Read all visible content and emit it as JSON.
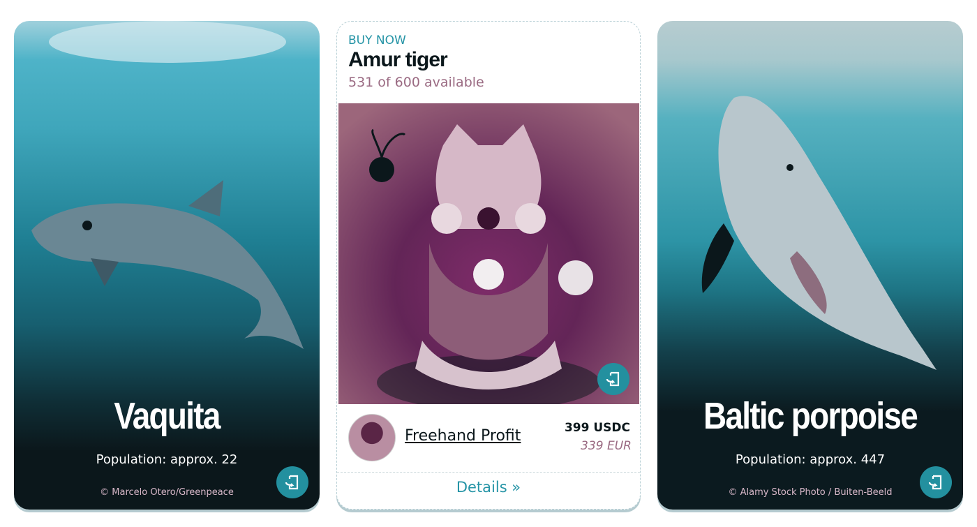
{
  "cards": [
    {
      "title": "Vaquita",
      "population": "Population: approx. 22",
      "credit": "© Marcelo Otero/Greenpeace",
      "share_icon": "share-exit-icon"
    },
    {
      "title": "Baltic porpoise",
      "population": "Population: approx. 447",
      "credit": "© Alamy Stock Photo / Buiten-Beeld",
      "share_icon": "share-exit-icon"
    }
  ],
  "featured": {
    "label": "BUY NOW",
    "title": "Amur tiger",
    "availability": "531 of 600 available",
    "seller": "Freehand Profit",
    "price_crypto": "399 USDC",
    "price_fiat": "339 EUR",
    "details": "Details »"
  },
  "colors": {
    "accent": "#2594a6",
    "muted": "#9a6a82",
    "dark": "#0b171b"
  }
}
